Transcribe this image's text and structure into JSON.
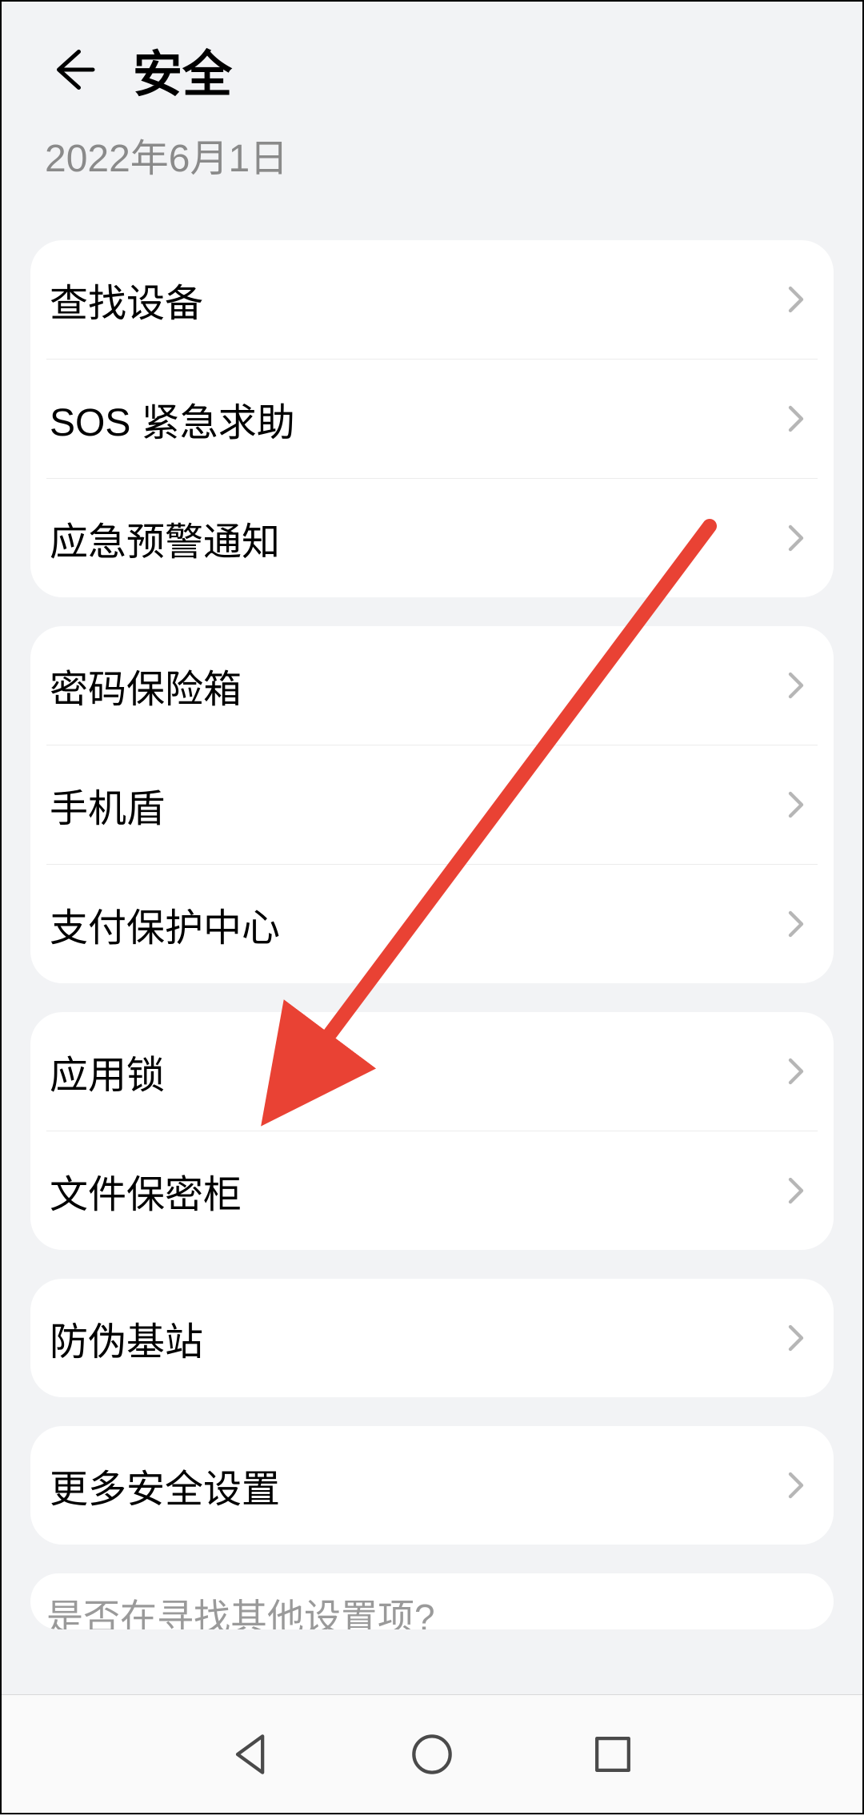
{
  "header": {
    "title": "安全",
    "date": "2022年6月1日"
  },
  "groups": [
    {
      "items": [
        "查找设备",
        "SOS 紧急求助",
        "应急预警通知"
      ]
    },
    {
      "items": [
        "密码保险箱",
        "手机盾",
        "支付保护中心"
      ]
    },
    {
      "items": [
        "应用锁",
        "文件保密柜"
      ]
    },
    {
      "items": [
        "防伪基站"
      ]
    },
    {
      "items": [
        "更多安全设置"
      ]
    }
  ],
  "hint": "是否在寻找其他设置项?",
  "colors": {
    "bg": "#f2f3f5",
    "card": "#ffffff",
    "text": "#000000",
    "subtext": "#8a8a8a",
    "chevron": "#b6b6b6",
    "arrow": "#e94234"
  }
}
